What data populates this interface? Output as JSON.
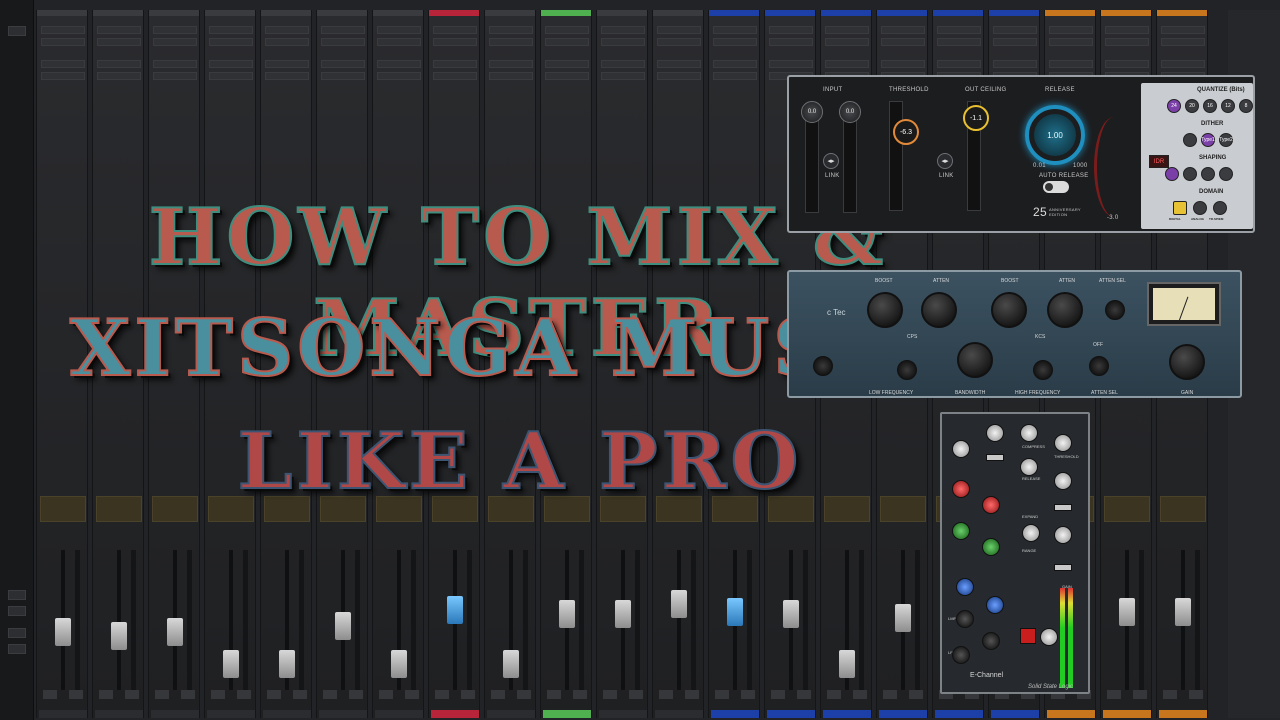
{
  "title": {
    "line1": "HOW TO MIX & MASTER",
    "line2": "XITSONGA MUSIC",
    "line3": "LIKE A PRO"
  },
  "limiter": {
    "input_label": "INPUT",
    "threshold_label": "THRESHOLD",
    "out_ceiling_label": "OUT CEILING",
    "release_label": "RELEASE",
    "input_left": "0.0",
    "input_right": "0.0",
    "threshold_value": "-6.3",
    "ceiling_value": "-1.1",
    "release_value": "1.00",
    "release_min": "0.01",
    "release_max": "1000",
    "link_label": "LINK",
    "auto_release_label": "AUTO RELEASE",
    "gr_readout": "-3.0",
    "anniversary_number": "25",
    "anniversary_text": "ANNIVERSARY EDITION",
    "quantize_label": "QUANTIZE (Bits)",
    "quantize_options": [
      "24",
      "20",
      "16",
      "12",
      "8"
    ],
    "dither_label": "DITHER",
    "dither_options": [
      "Type1",
      "Type2"
    ],
    "idr_label": "IDR",
    "shaping_label": "SHAPING",
    "domain_label": "DOMAIN",
    "domain_options": [
      "DIGITAL",
      "ANALOG",
      "TR-SPIEM"
    ]
  },
  "eq": {
    "boost_label": "BOOST",
    "atten_label": "ATTEN",
    "atten_sel_label": "ATTEN SEL",
    "cps_label": "CPS",
    "kcs_label": "KCS",
    "off_label": "OFF",
    "low_freq_label": "LOW FREQUENCY",
    "bandwidth_label": "BANDWIDTH",
    "high_freq_label": "HIGH FREQUENCY",
    "gain_label": "GAIN",
    "brand_fragment": "c Tec"
  },
  "echannel": {
    "name": "E-Channel",
    "brand": "Solid State Logic",
    "compress_label": "COMPRESS",
    "expand_label": "EXPAND",
    "threshold_label": "THRESHOLD",
    "release_label": "RELEASE",
    "range_label": "RANGE",
    "gain_label": "GAIN",
    "lmf_label": "LMF",
    "lf_label": "LF"
  }
}
